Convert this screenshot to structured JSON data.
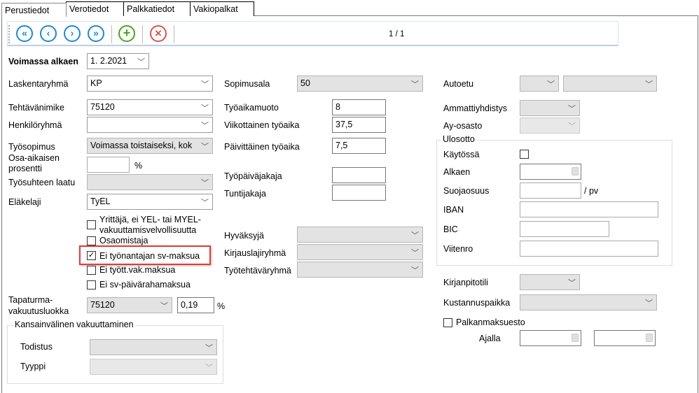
{
  "tabs": [
    "Perustiedot",
    "Verotiedot",
    "Palkkatiedot",
    "Vakiopalkat"
  ],
  "toolbar": {
    "first": "«",
    "prev": "‹",
    "next": "›",
    "last": "»",
    "add": "+",
    "delete": "×",
    "record": "1 / 1"
  },
  "left": {
    "voimassa_label": "Voimassa alkaen",
    "voimassa_value": "1.  2.2021",
    "laskentaryhma_label": "Laskentaryhmä",
    "laskentaryhma_value": "KP",
    "tehtavanimike_label": "Tehtävänimike",
    "tehtavanimike_value": "75120",
    "henkiloryhma_label": "Henkilöryhmä",
    "henkiloryhma_value": "",
    "tyosopimus_label": "Työsopimus",
    "tyosopimus_value": "Voimassa toistaiseksi, kok",
    "osa_label1": "Osa-aikaisen",
    "osa_label2": "prosentti",
    "osa_value": "",
    "osa_unit": "%",
    "laatu_label": "Työsuhteen laatu",
    "laatu_value": "",
    "elakelaji_label": "Eläkelaji",
    "elakelaji_value": "TyEL",
    "checks": [
      {
        "label1": "Yrittäjä, ei YEL- tai MYEL-",
        "label2": "vakuuttamisvelvollisuutta",
        "checked": false
      },
      {
        "label": "Osaomistaja",
        "checked": false
      },
      {
        "label": "Ei työnantajan sv-maksua",
        "checked": true
      },
      {
        "label": "Ei tyött.vak.maksua",
        "checked": false
      },
      {
        "label": "Ei sv-päivärahamaksua",
        "checked": false
      }
    ],
    "tapaturma_label1": "Tapaturma-",
    "tapaturma_label2": "vakuutusluokka",
    "tapaturma_value": "75120",
    "tapaturma_pct": "0,19",
    "tapaturma_unit": "%",
    "kv_legend": "Kansainvälinen vakuuttaminen",
    "todistus_label": "Todistus",
    "tyyppi_label": "Tyyppi"
  },
  "middle": {
    "sopimusala_label": "Sopimusala",
    "sopimusala_value": "50",
    "tyoaikamuoto_label": "Työaikamuoto",
    "tyoaikamuoto_value": "8",
    "viikko_label": "Viikottainen työaika",
    "viikko_value": "37,5",
    "paiva_label": "Päivittäinen työaika",
    "paiva_value": "7,5",
    "tpjakaja_label": "Työpäiväjakaja",
    "tpjakaja_value": "",
    "tuntijakaja_label": "Tuntijakaja",
    "tuntijakaja_value": "",
    "hyvaksyja_label": "Hyväksyjä",
    "kirjaus_label": "Kirjauslajiryhmä",
    "tyotehtava_label": "Työtehtäväryhmä"
  },
  "right": {
    "autoetu_label": "Autoetu",
    "ammatti_label": "Ammattiyhdistys",
    "ayosasto_label": "Ay-osasto",
    "ulosotto_legend": "Ulosotto",
    "kaytossa_label": "Käytössä",
    "alkaen_label": "Alkaen",
    "suoja_label": "Suojaosuus",
    "suoja_unit": "/ pv",
    "iban_label": "IBAN",
    "bic_label": "BIC",
    "viite_label": "Viitenro",
    "kirjanpito_label": "Kirjanpitotili",
    "kustannus_label": "Kustannuspaikka",
    "palkanmaksuesto_label": "Palkanmaksuesto",
    "ajalla_label": "Ajalla"
  },
  "colors": {
    "nav_blue": "#1e88d0",
    "add_green": "#4aa520",
    "delete_red": "#d9534f",
    "highlight": "#e53935"
  }
}
